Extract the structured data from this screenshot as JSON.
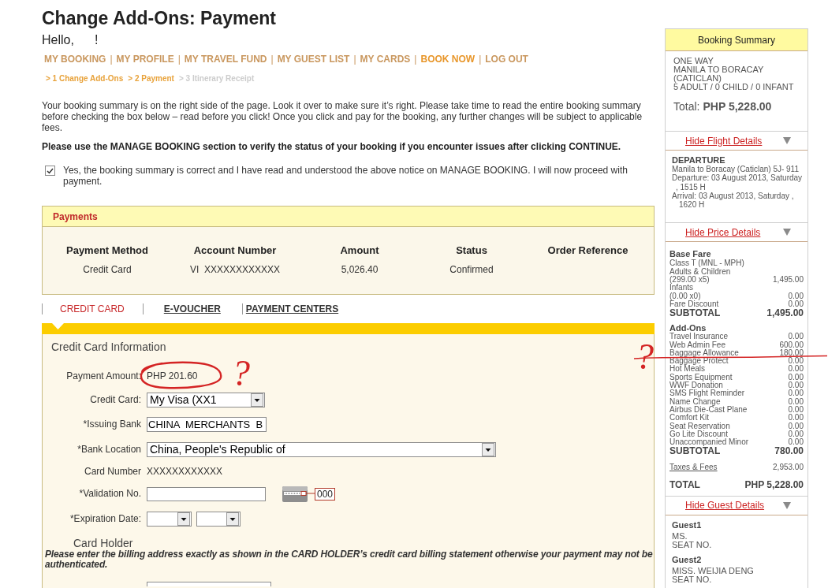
{
  "page": {
    "title": "Change Add-Ons: Payment",
    "greeting": "Hello,",
    "greeting_end": "!"
  },
  "nav": [
    {
      "label": "MY BOOKING",
      "emphasized": false,
      "separator": "|"
    },
    {
      "label": "MY PROFILE",
      "emphasized": false,
      "separator": "|"
    },
    {
      "label": "MY TRAVEL FUND",
      "emphasized": false,
      "separator": "|"
    },
    {
      "label": "MY GUEST LIST",
      "emphasized": false,
      "separator": "|"
    },
    {
      "label": "MY CARDS",
      "emphasized": false,
      "separator": "|"
    },
    {
      "label": "BOOK NOW",
      "emphasized": true,
      "separator": "|"
    },
    {
      "label": "LOG OUT",
      "emphasized": false
    }
  ],
  "steps": [
    {
      "label": "> 1 Change Add-Ons",
      "reached": true
    },
    {
      "label": "> 2 Payment",
      "reached": true
    },
    {
      "label": "> 3 Itinerary Receipt",
      "reached": false
    }
  ],
  "notice": "Your booking summary is on the right side of the page. Look it over to make sure it’s right. Please take time to read the entire booking summary before checking the box below – read before you click! Once you click and pay for the booking, any further changes will be subject to applicable fees.",
  "notice_bold": "Please use the MANAGE BOOKING section to verify the status of your booking if you encounter issues after clicking CONTINUE.",
  "consent": {
    "checked": true,
    "label": "Yes, the booking summary is correct and I have read and understood the above notice on MANAGE BOOKING. I will now proceed with payment."
  },
  "payments": {
    "title": "Payments",
    "columns": [
      "Payment Method",
      "Account Number",
      "Amount",
      "Status",
      "Order Reference"
    ],
    "rows": [
      [
        "Credit Card",
        "VI  XXXXXXXXXXXX",
        "5,026.40",
        "Confirmed"
      ]
    ]
  },
  "payment_tabs": [
    {
      "label": "CREDIT CARD",
      "selected": true
    },
    {
      "label": "E-VOUCHER",
      "selected": false
    },
    {
      "label": "PAYMENT CENTERS",
      "selected": false
    }
  ],
  "credit_card_form": {
    "title": "Credit Card Information",
    "fields": [
      {
        "kind": "text",
        "label": "Payment Amount:",
        "value": "PHP 201.60",
        "circled": true,
        "note": "?"
      },
      {
        "kind": "select",
        "label": "Credit Card:",
        "value": "My Visa (XX1"
      },
      {
        "kind": "input",
        "label": "*Issuing Bank",
        "value": "CHINA  MERCHANTS  B"
      },
      {
        "kind": "select",
        "label": "*Bank Location",
        "value": "China, People's Republic of"
      },
      {
        "kind": "text",
        "label": "Card Number",
        "value": "XXXXXXXXXXXX"
      },
      {
        "kind": "cvv",
        "label": "*Validation No.",
        "cvv_example": "000"
      },
      {
        "kind": "date",
        "label": "*Expiration Date:"
      }
    ]
  },
  "card_holder": {
    "title": "Card Holder",
    "instructions": "Please enter the billing address exactly as shown in the CARD HOLDER’s credit card billing statement otherwise your payment may not be authenticated."
  },
  "summary": {
    "title": "Booking Summary",
    "trip_type": "ONE WAY",
    "route": "MANILA TO BORACAY (CATICLAN)",
    "passengers": "5 ADULT / 0 CHILD / 0 INFANT",
    "total_label": "Total:",
    "total_value": "PHP 5,228.00",
    "flight_toggle": "Hide Flight Details",
    "flight": {
      "heading": "DEPARTURE",
      "route": "Manila to Boracay (Caticlan) 5J- 911",
      "departure": "Departure: 03 August 2013, Saturday",
      "departure_time": ", 1515 H",
      "arrival": "Arrival: 03 August 2013, Saturday ,",
      "arrival_time": "1620 H"
    },
    "price_toggle": "Hide Price Details",
    "base_fare": {
      "heading": "Base Fare",
      "lines": [
        {
          "label": "Class T (MNL - MPH)"
        },
        {
          "label": "Adults & Children"
        },
        {
          "label": "(299.00 x5)",
          "amount": "1,495.00"
        },
        {
          "label": "Infants"
        },
        {
          "label": "(0.00 x0)",
          "amount": "0.00"
        },
        {
          "label": "Fare Discount",
          "amount": "0.00"
        }
      ],
      "subtotal_label": "SUBTOTAL",
      "subtotal": "1,495.00"
    },
    "add_ons": {
      "heading": "Add-Ons",
      "items": [
        {
          "label": "Travel Insurance",
          "amount": "0.00"
        },
        {
          "label": "Web Admin Fee",
          "amount": "600.00"
        },
        {
          "label": "Baggage Allowance",
          "amount": "180.00"
        },
        {
          "label": "Baggage Protect",
          "amount": "0.00"
        },
        {
          "label": "Hot Meals",
          "amount": "0.00"
        },
        {
          "label": "Sports Equipment",
          "amount": "0.00"
        },
        {
          "label": "WWF Donation",
          "amount": "0.00"
        },
        {
          "label": "SMS Flight Reminder",
          "amount": "0.00"
        },
        {
          "label": "Name Change",
          "amount": "0.00"
        },
        {
          "label": "Airbus Die-Cast Plane",
          "amount": "0.00"
        },
        {
          "label": "Comfort Kit",
          "amount": "0.00"
        },
        {
          "label": "Seat Reservation",
          "amount": "0.00"
        },
        {
          "label": "Go Lite Discount",
          "amount": "0.00"
        },
        {
          "label": "Unaccompanied Minor",
          "amount": "0.00"
        }
      ],
      "subtotal_label": "SUBTOTAL",
      "subtotal": "780.00"
    },
    "taxes": {
      "label": "Taxes & Fees",
      "amount": "2,953.00"
    },
    "total": {
      "label": "TOTAL",
      "amount": "PHP 5,228.00"
    },
    "guest_toggle": "Hide Guest Details",
    "guests": [
      {
        "heading": "Guest1",
        "name": "MS.",
        "seat": "SEAT NO."
      },
      {
        "heading": "Guest2",
        "name": "MISS. WEIJIA DENG",
        "seat": "SEAT NO."
      }
    ]
  },
  "annotations": [
    {
      "kind": "mark",
      "text": "?"
    },
    {
      "kind": "line"
    }
  ]
}
